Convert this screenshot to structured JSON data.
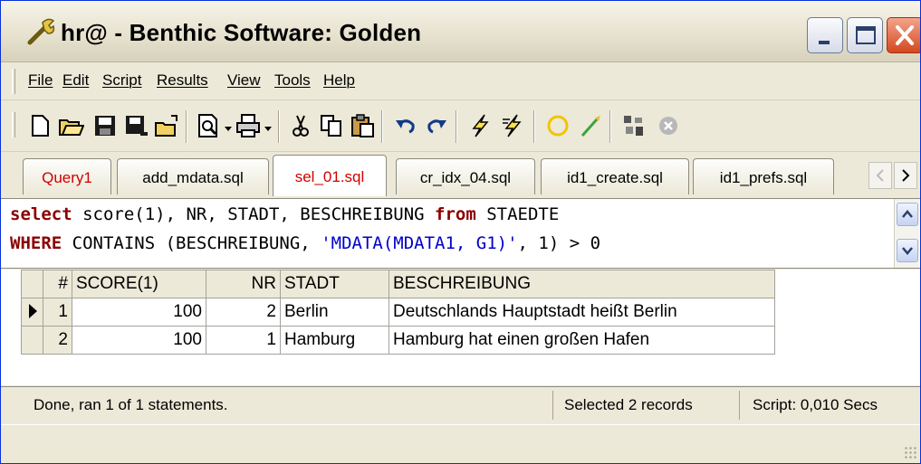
{
  "window": {
    "title": "hr@ - Benthic Software: Golden",
    "icon": "wrench-icon",
    "controls": [
      "minimize-icon",
      "maximize-icon",
      "close-icon"
    ]
  },
  "menu": {
    "items": [
      {
        "label": "File"
      },
      {
        "label": "Edit"
      },
      {
        "label": "Script"
      },
      {
        "label": "Results"
      },
      {
        "label": "View"
      },
      {
        "label": "Tools"
      },
      {
        "label": "Help"
      }
    ]
  },
  "toolbar": {
    "buttons": [
      "new-icon",
      "open-icon",
      "save-icon",
      "save-all-icon",
      "open-recent-icon",
      "preview-icon",
      "print-icon",
      "cut-icon",
      "copy-icon",
      "paste-icon",
      "undo-icon",
      "redo-icon",
      "execute-icon",
      "execute-step-icon",
      "commit-circle-icon",
      "rollback-icon",
      "explain-icon",
      "stop-icon"
    ]
  },
  "tabs": [
    {
      "label": "Query1"
    },
    {
      "label": "add_mdata.sql"
    },
    {
      "label": "sel_01.sql"
    },
    {
      "label": "cr_idx_04.sql"
    },
    {
      "label": "id1_create.sql"
    },
    {
      "label": "id1_prefs.sql"
    }
  ],
  "editor": {
    "line1": {
      "kw1": "select",
      "text1": " score(1), NR, STADT, BESCHREIBUNG ",
      "kw2": "from",
      "text2": " STAEDTE"
    },
    "line2": {
      "kw1": "WHERE",
      "text1": " CONTAINS (BESCHREIBUNG, ",
      "str": "'MDATA(MDATA1, G1)'",
      "text2": ", 1) > 0"
    }
  },
  "grid": {
    "columns": [
      "#",
      "SCORE(1)",
      "NR",
      "STADT",
      "BESCHREIBUNG"
    ],
    "rows": [
      {
        "n": "1",
        "score": "100",
        "nr": "2",
        "stadt": "Berlin",
        "beschreibung": "Deutschlands Hauptstadt heißt Berlin"
      },
      {
        "n": "2",
        "score": "100",
        "nr": "1",
        "stadt": "Hamburg",
        "beschreibung": "Hamburg hat einen großen Hafen"
      }
    ]
  },
  "status": {
    "message": "Done, ran 1 of 1 statements.",
    "selected": "Selected 2 records",
    "script_time": "Script: 0,010 Secs"
  }
}
